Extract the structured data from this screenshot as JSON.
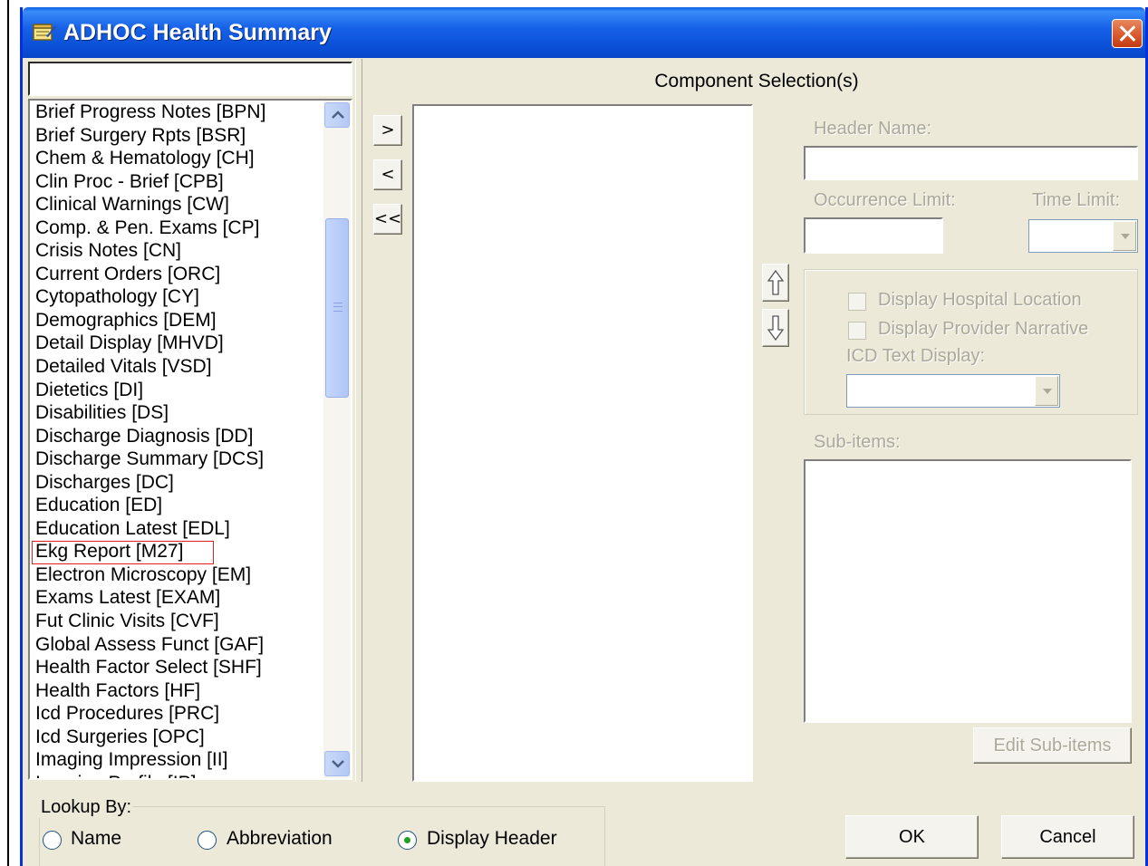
{
  "window": {
    "title": "ADHOC Health Summary"
  },
  "search": {
    "value": ""
  },
  "components": [
    "Brief Progress Notes  [BPN]",
    "Brief Surgery Rpts  [BSR]",
    "Chem & Hematology  [CH]",
    "Clin Proc - Brief  [CPB]",
    "Clinical Warnings  [CW]",
    "Comp. & Pen. Exams  [CP]",
    "Crisis Notes  [CN]",
    "Current Orders  [ORC]",
    "Cytopathology  [CY]",
    "Demographics  [DEM]",
    "Detail Display  [MHVD]",
    "Detailed Vitals  [VSD]",
    "Dietetics  [DI]",
    "Disabilities  [DS]",
    "Discharge Diagnosis  [DD]",
    "Discharge Summary  [DCS]",
    "Discharges  [DC]",
    "Education  [ED]",
    "Education Latest  [EDL]",
    "Ekg Report  [M27]",
    "Electron Microscopy  [EM]",
    "Exams Latest  [EXAM]",
    "Fut Clinic Visits  [CVF]",
    "Global Assess Funct  [GAF]",
    "Health Factor Select  [SHF]",
    "Health Factors  [HF]",
    "Icd Procedures  [PRC]",
    "Icd Surgeries  [OPC]",
    "Imaging Impression  [II]",
    "Imaging Profile  [IP]"
  ],
  "highlighted_index": 19,
  "selection": {
    "title": "Component Selection(s)",
    "add_label": ">",
    "remove_label": "<",
    "remove_all_label": "<<"
  },
  "props": {
    "header_name_label": "Header Name:",
    "header_name_value": "",
    "occurrence_label": "Occurrence Limit:",
    "occurrence_value": "",
    "time_label": "Time Limit:",
    "display_hospital_label": "Display Hospital Location",
    "display_provider_label": "Display Provider Narrative",
    "icd_text_label": "ICD Text Display:",
    "subitems_label": "Sub-items:",
    "edit_subitems_label": "Edit Sub-items"
  },
  "lookup": {
    "legend": "Lookup By:",
    "options": [
      {
        "label": "Name",
        "selected": false
      },
      {
        "label": "Abbreviation",
        "selected": false
      },
      {
        "label": "Display Header",
        "selected": true
      }
    ]
  },
  "actions": {
    "ok_label": "OK",
    "cancel_label": "Cancel"
  },
  "colors": {
    "titlebar": "#0a4fd6",
    "dialog": "#ece9d8",
    "highlight_border": "#e02020"
  }
}
